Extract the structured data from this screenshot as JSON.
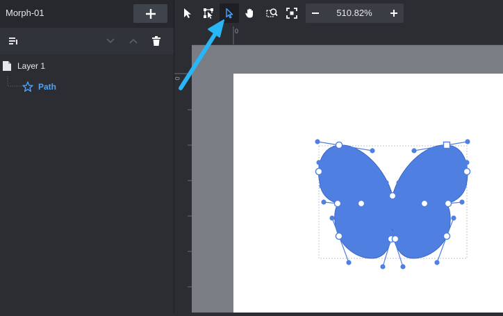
{
  "document": {
    "title": "Morph-01",
    "add_icon": "plus-icon"
  },
  "layers_panel": {
    "toolbar_icons": [
      "sort-list-icon",
      "chevron-down-icon",
      "chevron-up-icon",
      "trash-icon"
    ],
    "layers": [
      {
        "label": "Layer 1",
        "icon": "document-icon",
        "color": "#e6e8ec"
      },
      {
        "label": "Path",
        "icon": "star-outline-icon",
        "color": "#4aa3ff",
        "selected": true
      }
    ]
  },
  "toolbar": {
    "tools": [
      {
        "name": "select-tool",
        "icon": "arrow-pointer-icon"
      },
      {
        "name": "transform-tool",
        "icon": "transform-icon"
      },
      {
        "name": "direct-select-tool",
        "icon": "hollow-pointer-icon",
        "active": true
      },
      {
        "name": "pan-tool",
        "icon": "hand-icon"
      },
      {
        "name": "zoom-to-selection-tool",
        "icon": "zoom-selection-icon"
      },
      {
        "name": "fit-canvas-tool",
        "icon": "fit-screen-icon"
      }
    ],
    "zoom": {
      "value": "510.82%",
      "minus_icon": "minus-icon",
      "plus_icon": "plus-icon"
    }
  },
  "rulers": {
    "origin_label": "0"
  },
  "colors": {
    "accent": "#4aa3ff",
    "shape_fill": "#4f7fe0",
    "panel": "#2b2d33",
    "canvas": "#7a7d84",
    "annotation_arrow": "#29b6f6"
  }
}
